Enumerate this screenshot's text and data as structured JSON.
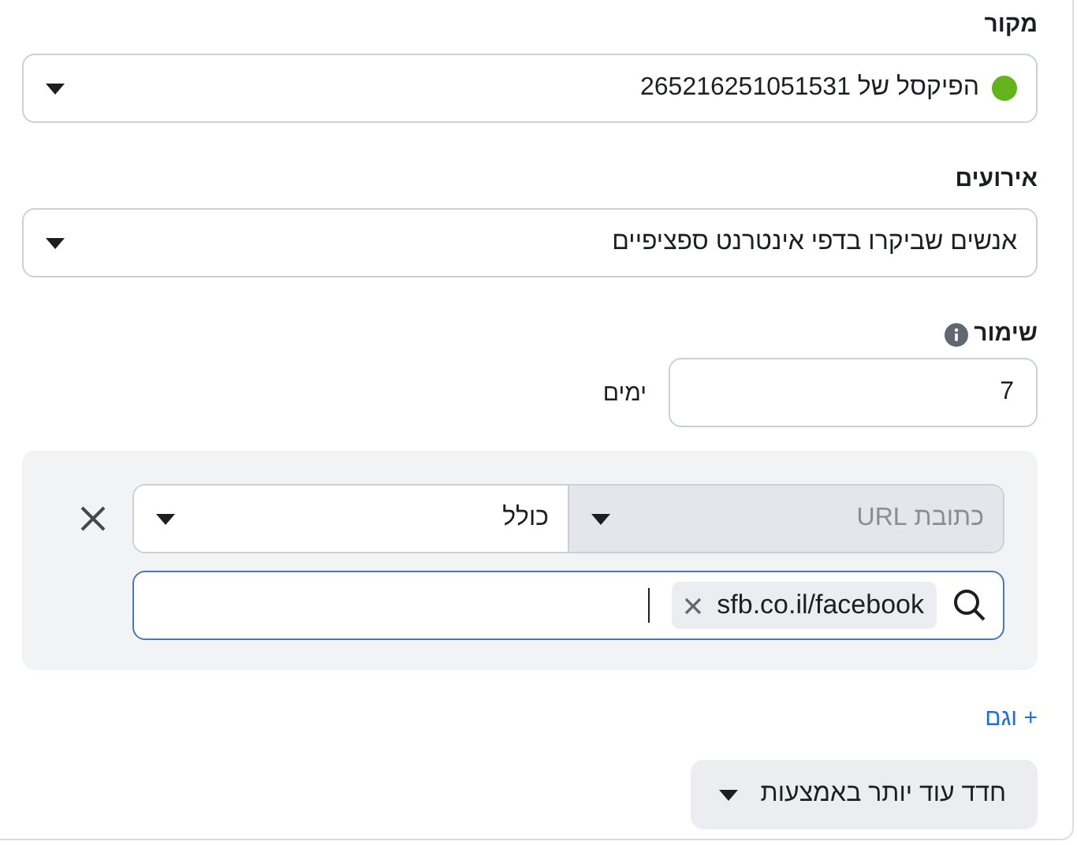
{
  "source": {
    "label": "מקור",
    "value": "הפיקסל של 265216251051531",
    "color": "#63b31d"
  },
  "events": {
    "label": "אירועים",
    "value": "אנשים שביקרו בדפי אינטרנט ספציפיים"
  },
  "retention": {
    "label": "שימור",
    "value": "7",
    "unit": "ימים"
  },
  "rule": {
    "field": {
      "value": "כתובת URL",
      "disabled": true
    },
    "operator": {
      "value": "כולל",
      "disabled": false
    },
    "chips": [
      "sfb.co.il/facebook"
    ]
  },
  "add_link": "+ וגם",
  "refine_button": "חדד עוד יותר באמצעות"
}
